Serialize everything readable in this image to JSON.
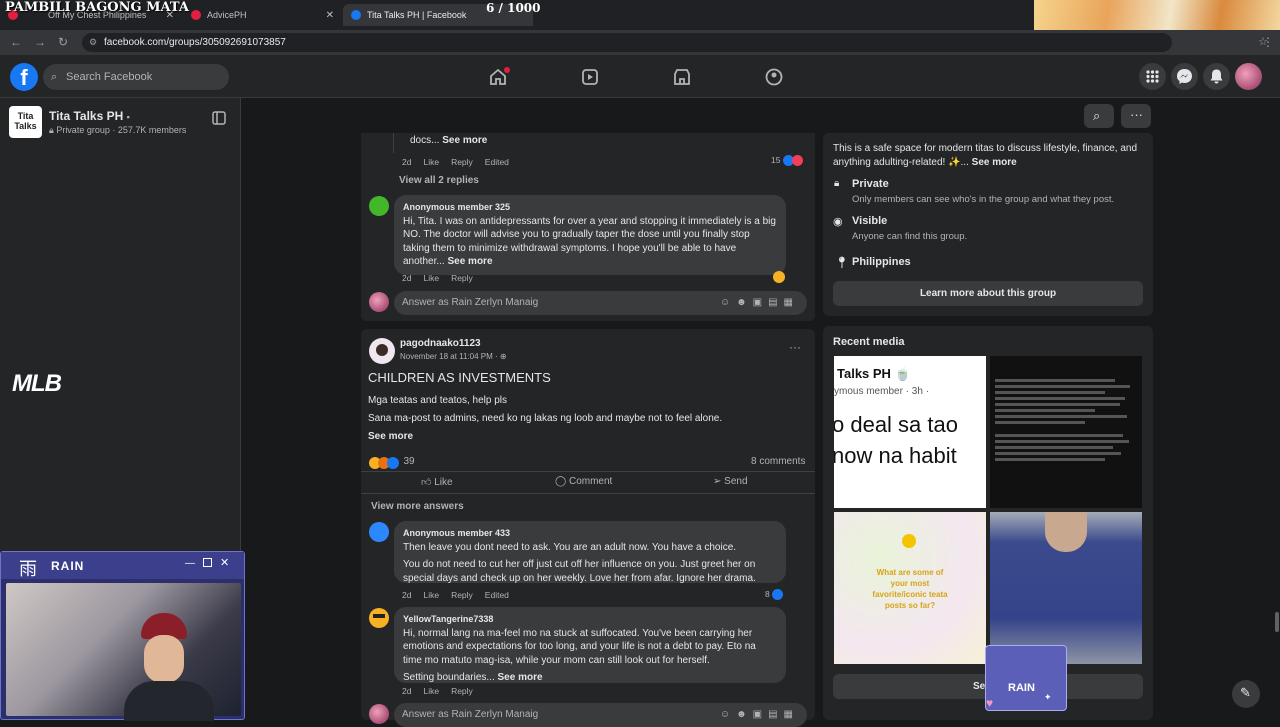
{
  "overlay": {
    "title": "PAMBILI BAGONG MATA",
    "counter": "6 / 1000"
  },
  "browser": {
    "tabs": [
      {
        "label": "Off My Chest Philippines"
      },
      {
        "label": "AdvicePH"
      },
      {
        "label": "Tita Talks PH | Facebook"
      }
    ],
    "url": "facebook.com/groups/305092691073857"
  },
  "fb": {
    "search_placeholder": "Search Facebook"
  },
  "group": {
    "name": "Tita Talks PH",
    "meta": "Private group · 257.7K members",
    "logo_text": "Tita Talks"
  },
  "streamer": {
    "brand": "RAIN",
    "kanji": "雨",
    "sticky_brand": "RAIN"
  },
  "side_logo": "MLB",
  "post1": {
    "top_comment_tail": "docs...",
    "see_more": "See more",
    "top_meta": {
      "time": "2d",
      "like": "Like",
      "reply": "Reply",
      "edited": "Edited",
      "count": "15"
    },
    "view_replies": "View all 2 replies",
    "comment": {
      "name": "Anonymous member 325",
      "text": "Hi, Tita. I was on antidepressants for over a year and stopping it immediately is a big NO. The doctor will advise you to gradually taper the dose until you finally stop taking them to minimize withdrawal symptoms. I hope you'll be able to have another...",
      "see_more": "See more",
      "time": "2d",
      "like": "Like",
      "reply": "Reply"
    },
    "answer_placeholder": "Answer as Rain Zerlyn Manaig"
  },
  "post2": {
    "author": "pagodnaako1123",
    "date": "November 18 at 11:04 PM · ",
    "title": "CHILDREN AS INVESTMENTS",
    "line1": "Mga teatas and teatos, help pls",
    "line2": "Sana ma-post to admins, need ko ng lakas ng loob and maybe not to feel alone.",
    "see_more": "See more",
    "reactions": "39",
    "comments": "8 comments",
    "actions": {
      "like": "Like",
      "comment": "Comment",
      "send": "Send"
    },
    "view_more": "View more answers",
    "comments_list": [
      {
        "name": "Anonymous member 433",
        "p1": "Then leave you dont need to ask. You are an adult now. You have a choice.",
        "p2": "You do not need to cut her off just cut off her influence on you. Just greet her on special days and check up on her weekly. Love her from afar. Ignore her drama.",
        "time": "2d",
        "like": "Like",
        "reply": "Reply",
        "edited": "Edited",
        "count": "8"
      },
      {
        "name": "YellowTangerine7338",
        "p1": "Hi, normal lang na ma-feel mo na stuck at suffocated. You've been carrying her emotions and expectations for too long, and your life is not a debt to pay. Eto na time mo matuto mag-isa, while your mom can still look out for herself.",
        "p2": "Setting boundaries...",
        "see_more": "See more",
        "time": "2d",
        "like": "Like",
        "reply": "Reply"
      }
    ],
    "answer_placeholder": "Answer as Rain Zerlyn Manaig"
  },
  "about": {
    "description": "This is a safe space for modern titas to discuss lifestyle, finance, and anything adulting-related! ✨...",
    "see_more": "See more",
    "private_title": "Private",
    "private_desc": "Only members can see who's in the group and what they post.",
    "visible_title": "Visible",
    "visible_desc": "Anyone can find this group.",
    "location": "Philippines",
    "learn_more": "Learn more about this group"
  },
  "media": {
    "title": "Recent media",
    "m1": {
      "group": "Talks PH 🍵",
      "sub": "ymous member · 3h · ",
      "big1": "o deal sa tao",
      "big2": "now na habit"
    },
    "m3": {
      "line1": "What are some of",
      "line2": "your most",
      "line3": "favorite/iconic teata",
      "line4": "posts so far?"
    },
    "see_all_partial": "Se"
  },
  "colors": {
    "fb_blue": "#1877f2",
    "bg": "#18191a",
    "card": "#242526",
    "stream_purple": "#3b3f8c"
  }
}
